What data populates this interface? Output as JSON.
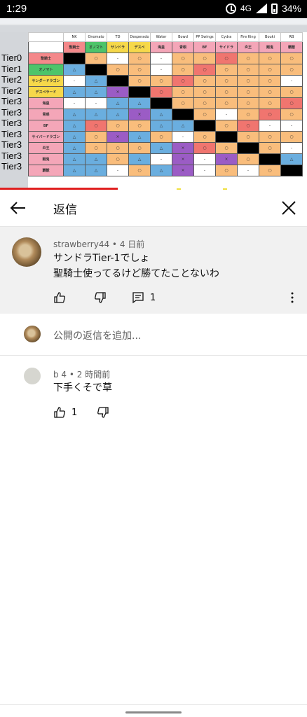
{
  "status_bar": {
    "time": "1:29",
    "network": "4G",
    "battery": "34%"
  },
  "sheet": {
    "columns": [
      "NK",
      "Onomato",
      "TD",
      "Desperado",
      "Water",
      "Bowd",
      "PP Swings",
      "Cydra",
      "Fire King",
      "Bouki",
      "RB"
    ],
    "header_labels": [
      "聖騎士",
      "オノマト",
      "サンドラ",
      "デスペ",
      "海皇",
      "青眼",
      "BF",
      "サイドラ",
      "炎王",
      "剛鬼",
      "覇獣"
    ],
    "tiers": [
      "Tier0",
      "Tier1",
      "Tier2",
      "Tier2",
      "Tier3",
      "Tier3",
      "Tier3",
      "Tier3",
      "Tier3",
      "Tier3",
      "Tier3"
    ],
    "rows": [
      {
        "name": "聖騎士",
        "color": "#f4888a",
        "cells": [
          "",
          "○",
          "-",
          "○",
          "-",
          "○",
          "○",
          "○",
          "○",
          "○",
          "○"
        ]
      },
      {
        "name": "オノマト",
        "color": "#4dc46a",
        "cells": [
          "△",
          "",
          "○",
          "○",
          "-",
          "○",
          "○",
          "○",
          "○",
          "○",
          "○"
        ]
      },
      {
        "name": "サンダードラゴン",
        "color": "#f6d84a",
        "cells": [
          "-",
          "△",
          "",
          "○",
          "○",
          "○",
          "○",
          "○",
          "○",
          "○",
          "-"
        ]
      },
      {
        "name": "デスペラード",
        "color": "#f6d84a",
        "cells": [
          "△",
          "△",
          "×",
          "",
          "○",
          "○",
          "○",
          "○",
          "○",
          "○",
          "○"
        ]
      },
      {
        "name": "海皇",
        "color": "#f4a6b8",
        "cells": [
          "-",
          "-",
          "△",
          "△",
          "",
          "○",
          "○",
          "○",
          "○",
          "○",
          "○"
        ]
      },
      {
        "name": "青眼",
        "color": "#f4a6b8",
        "cells": [
          "△",
          "△",
          "△",
          "×",
          "△",
          "",
          "○",
          "-",
          "○",
          "○",
          "○"
        ]
      },
      {
        "name": "BF",
        "color": "#f4a6b8",
        "cells": [
          "△",
          "○",
          "○",
          "○",
          "△",
          "△",
          "",
          "○",
          "○",
          "-",
          "-"
        ]
      },
      {
        "name": "サイバードラゴン",
        "color": "#f4a6b8",
        "cells": [
          "△",
          "○",
          "×",
          "△",
          "○",
          "-",
          "○",
          "",
          "○",
          "○",
          "○"
        ]
      },
      {
        "name": "炎王",
        "color": "#f4a6b8",
        "cells": [
          "△",
          "○",
          "○",
          "○",
          "△",
          "×",
          "○",
          "○",
          "",
          "○",
          "-"
        ]
      },
      {
        "name": "剛鬼",
        "color": "#f4a6b8",
        "cells": [
          "△",
          "△",
          "○",
          "△",
          "-",
          "×",
          "-",
          "×",
          "○",
          "",
          "△"
        ]
      },
      {
        "name": "覇獣",
        "color": "#f4a6b8",
        "cells": [
          "△",
          "△",
          "-",
          "○",
          "△",
          "×",
          "-",
          "○",
          "-",
          "○",
          ""
        ]
      }
    ],
    "cell_colors": {
      "blank": "#000000",
      "win": "#f9bd7c",
      "lose": "#6aaedf",
      "even": "#ffffff",
      "strong_lose": "#9b5cc5",
      "strong_win": "#f0756f"
    }
  },
  "header": {
    "title": "返信"
  },
  "parent_comment": {
    "author": "strawberry44",
    "time": "4 日前",
    "line1": "サンドラTier-1でしょ",
    "line2": "聖騎士使ってるけど勝てたことないわ",
    "reply_count": "1"
  },
  "add_reply": {
    "placeholder": "公開の返信を追加..."
  },
  "reply": {
    "author": "b 4",
    "time": "2 時間前",
    "text": "下手くそで草",
    "like_count": "1"
  }
}
